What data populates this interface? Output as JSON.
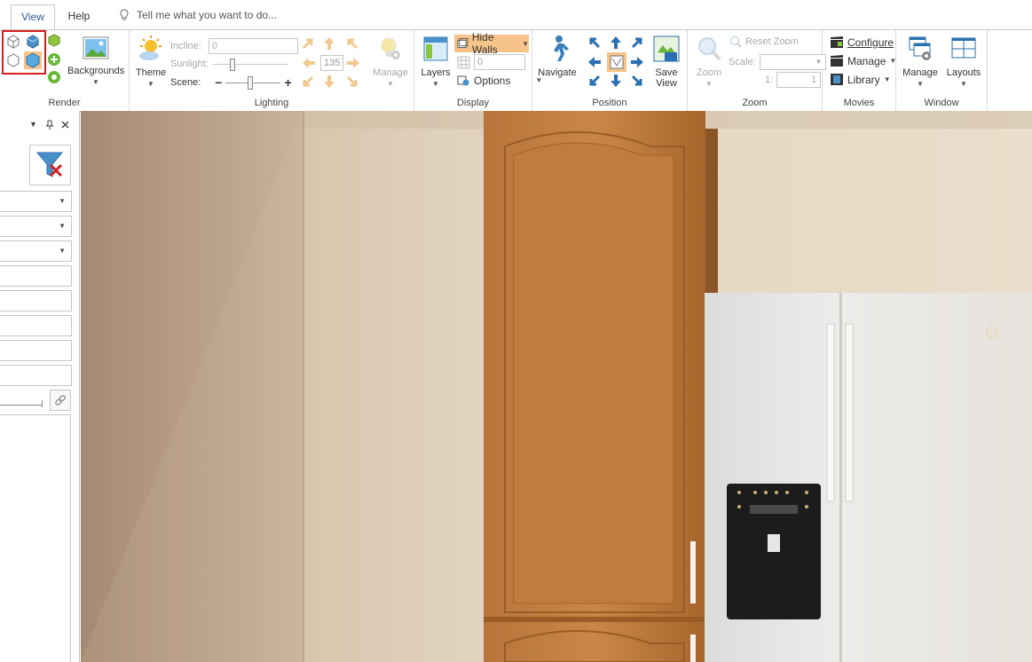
{
  "tabs": [
    {
      "label": "View",
      "active": true
    },
    {
      "label": "Help",
      "active": false
    }
  ],
  "tell_me": {
    "placeholder": "Tell me what you want to do..."
  },
  "ribbon": {
    "render": {
      "label": "Render",
      "backgrounds": "Backgrounds"
    },
    "lighting": {
      "label": "Lighting",
      "theme": "Theme",
      "incline_label": "Incline:",
      "incline_value": "0",
      "sunlight_label": "Sunlight:",
      "sunlight_value": "135",
      "scene_label": "Scene:",
      "minus": "−",
      "plus": "+",
      "manage": "Manage"
    },
    "display": {
      "label": "Display",
      "layers": "Layers",
      "hide_walls": "Hide Walls",
      "grid_value": "0",
      "options": "Options"
    },
    "position": {
      "label": "Position",
      "navigate": "Navigate",
      "save_view_line1": "Save",
      "save_view_line2": "View"
    },
    "zoom": {
      "label": "Zoom",
      "zoom": "Zoom",
      "reset_zoom": "Reset Zoom",
      "scale_label": "Scale:",
      "ratio_left": "1:",
      "ratio_right": "1"
    },
    "movies": {
      "label": "Movies",
      "configure": "Configure",
      "manage": "Manage",
      "library": "Library"
    },
    "window": {
      "label": "Window",
      "manage": "Manage",
      "layouts": "Layouts"
    }
  },
  "colors": {
    "accent": "#2b579a",
    "highlight": "#f6c48a",
    "selection": "#d42020"
  }
}
